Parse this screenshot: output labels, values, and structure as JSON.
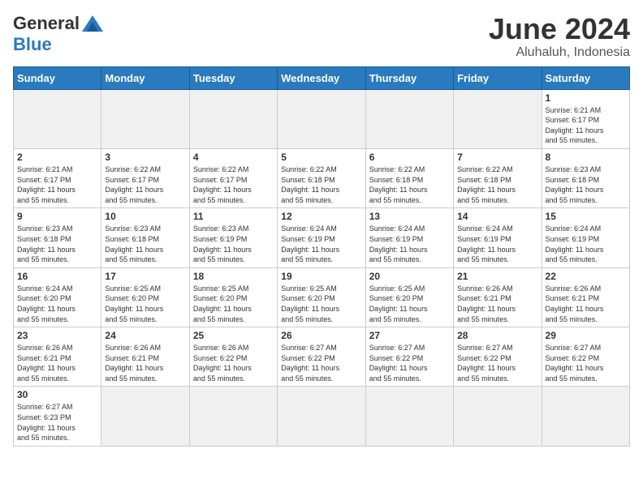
{
  "header": {
    "logo_general": "General",
    "logo_blue": "Blue",
    "title": "June 2024",
    "subtitle": "Aluhaluh, Indonesia"
  },
  "days_of_week": [
    "Sunday",
    "Monday",
    "Tuesday",
    "Wednesday",
    "Thursday",
    "Friday",
    "Saturday"
  ],
  "weeks": [
    [
      {
        "day": "",
        "info": ""
      },
      {
        "day": "",
        "info": ""
      },
      {
        "day": "",
        "info": ""
      },
      {
        "day": "",
        "info": ""
      },
      {
        "day": "",
        "info": ""
      },
      {
        "day": "",
        "info": ""
      },
      {
        "day": "1",
        "info": "Sunrise: 6:21 AM\nSunset: 6:17 PM\nDaylight: 11 hours\nand 55 minutes."
      }
    ],
    [
      {
        "day": "2",
        "info": "Sunrise: 6:21 AM\nSunset: 6:17 PM\nDaylight: 11 hours\nand 55 minutes."
      },
      {
        "day": "3",
        "info": "Sunrise: 6:22 AM\nSunset: 6:17 PM\nDaylight: 11 hours\nand 55 minutes."
      },
      {
        "day": "4",
        "info": "Sunrise: 6:22 AM\nSunset: 6:17 PM\nDaylight: 11 hours\nand 55 minutes."
      },
      {
        "day": "5",
        "info": "Sunrise: 6:22 AM\nSunset: 6:18 PM\nDaylight: 11 hours\nand 55 minutes."
      },
      {
        "day": "6",
        "info": "Sunrise: 6:22 AM\nSunset: 6:18 PM\nDaylight: 11 hours\nand 55 minutes."
      },
      {
        "day": "7",
        "info": "Sunrise: 6:22 AM\nSunset: 6:18 PM\nDaylight: 11 hours\nand 55 minutes."
      },
      {
        "day": "8",
        "info": "Sunrise: 6:23 AM\nSunset: 6:18 PM\nDaylight: 11 hours\nand 55 minutes."
      }
    ],
    [
      {
        "day": "9",
        "info": "Sunrise: 6:23 AM\nSunset: 6:18 PM\nDaylight: 11 hours\nand 55 minutes."
      },
      {
        "day": "10",
        "info": "Sunrise: 6:23 AM\nSunset: 6:18 PM\nDaylight: 11 hours\nand 55 minutes."
      },
      {
        "day": "11",
        "info": "Sunrise: 6:23 AM\nSunset: 6:19 PM\nDaylight: 11 hours\nand 55 minutes."
      },
      {
        "day": "12",
        "info": "Sunrise: 6:24 AM\nSunset: 6:19 PM\nDaylight: 11 hours\nand 55 minutes."
      },
      {
        "day": "13",
        "info": "Sunrise: 6:24 AM\nSunset: 6:19 PM\nDaylight: 11 hours\nand 55 minutes."
      },
      {
        "day": "14",
        "info": "Sunrise: 6:24 AM\nSunset: 6:19 PM\nDaylight: 11 hours\nand 55 minutes."
      },
      {
        "day": "15",
        "info": "Sunrise: 6:24 AM\nSunset: 6:19 PM\nDaylight: 11 hours\nand 55 minutes."
      }
    ],
    [
      {
        "day": "16",
        "info": "Sunrise: 6:24 AM\nSunset: 6:20 PM\nDaylight: 11 hours\nand 55 minutes."
      },
      {
        "day": "17",
        "info": "Sunrise: 6:25 AM\nSunset: 6:20 PM\nDaylight: 11 hours\nand 55 minutes."
      },
      {
        "day": "18",
        "info": "Sunrise: 6:25 AM\nSunset: 6:20 PM\nDaylight: 11 hours\nand 55 minutes."
      },
      {
        "day": "19",
        "info": "Sunrise: 6:25 AM\nSunset: 6:20 PM\nDaylight: 11 hours\nand 55 minutes."
      },
      {
        "day": "20",
        "info": "Sunrise: 6:25 AM\nSunset: 6:20 PM\nDaylight: 11 hours\nand 55 minutes."
      },
      {
        "day": "21",
        "info": "Sunrise: 6:26 AM\nSunset: 6:21 PM\nDaylight: 11 hours\nand 55 minutes."
      },
      {
        "day": "22",
        "info": "Sunrise: 6:26 AM\nSunset: 6:21 PM\nDaylight: 11 hours\nand 55 minutes."
      }
    ],
    [
      {
        "day": "23",
        "info": "Sunrise: 6:26 AM\nSunset: 6:21 PM\nDaylight: 11 hours\nand 55 minutes."
      },
      {
        "day": "24",
        "info": "Sunrise: 6:26 AM\nSunset: 6:21 PM\nDaylight: 11 hours\nand 55 minutes."
      },
      {
        "day": "25",
        "info": "Sunrise: 6:26 AM\nSunset: 6:22 PM\nDaylight: 11 hours\nand 55 minutes."
      },
      {
        "day": "26",
        "info": "Sunrise: 6:27 AM\nSunset: 6:22 PM\nDaylight: 11 hours\nand 55 minutes."
      },
      {
        "day": "27",
        "info": "Sunrise: 6:27 AM\nSunset: 6:22 PM\nDaylight: 11 hours\nand 55 minutes."
      },
      {
        "day": "28",
        "info": "Sunrise: 6:27 AM\nSunset: 6:22 PM\nDaylight: 11 hours\nand 55 minutes."
      },
      {
        "day": "29",
        "info": "Sunrise: 6:27 AM\nSunset: 6:22 PM\nDaylight: 11 hours\nand 55 minutes."
      }
    ],
    [
      {
        "day": "30",
        "info": "Sunrise: 6:27 AM\nSunset: 6:23 PM\nDaylight: 11 hours\nand 55 minutes."
      },
      {
        "day": "",
        "info": ""
      },
      {
        "day": "",
        "info": ""
      },
      {
        "day": "",
        "info": ""
      },
      {
        "day": "",
        "info": ""
      },
      {
        "day": "",
        "info": ""
      },
      {
        "day": "",
        "info": ""
      }
    ]
  ]
}
